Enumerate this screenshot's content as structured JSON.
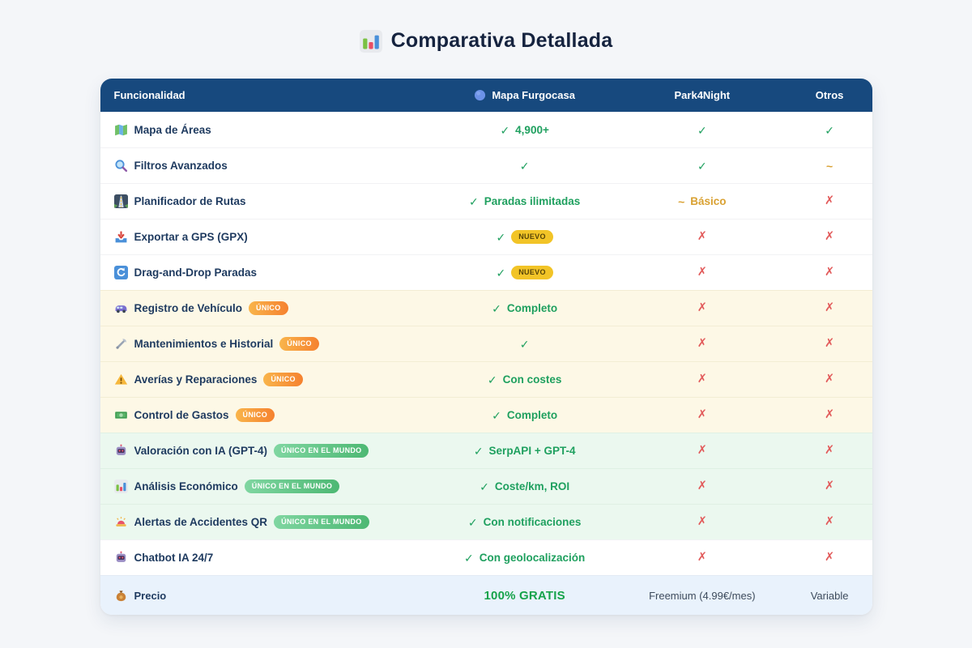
{
  "title": {
    "icon": "bar-chart",
    "text": "Comparativa Detallada"
  },
  "table": {
    "header": {
      "funcionalidad": "Funcionalidad",
      "furgocasa": "Mapa Furgocasa",
      "furgocasa_icon": "globe",
      "park4night": "Park4Night",
      "otros": "Otros"
    },
    "symbols": {
      "check": "✓",
      "cross": "✗",
      "tilde": "~"
    },
    "badge_labels": {
      "nuevo": "NUEVO",
      "unico": "ÚNICO",
      "unico_mundo": "ÚNICO EN EL MUNDO"
    },
    "rows": [
      {
        "icon": "world-map",
        "label": "Mapa de Áreas",
        "badge": null,
        "tint": "white",
        "cells": [
          {
            "mark": "check",
            "text": "4,900+"
          },
          {
            "mark": "check"
          },
          {
            "mark": "check"
          }
        ]
      },
      {
        "icon": "magnifier",
        "label": "Filtros Avanzados",
        "badge": null,
        "tint": "white",
        "cells": [
          {
            "mark": "check"
          },
          {
            "mark": "check"
          },
          {
            "mark": "tilde"
          }
        ]
      },
      {
        "icon": "motorway",
        "label": "Planificador de Rutas",
        "badge": null,
        "tint": "white",
        "cells": [
          {
            "mark": "check",
            "text": "Paradas ilimitadas"
          },
          {
            "mark": "tilde",
            "text": "Básico"
          },
          {
            "mark": "cross"
          }
        ]
      },
      {
        "icon": "inbox-download",
        "label": "Exportar a GPS (GPX)",
        "badge": null,
        "tint": "white",
        "cells": [
          {
            "mark": "check",
            "badge": "nuevo"
          },
          {
            "mark": "cross"
          },
          {
            "mark": "cross"
          }
        ]
      },
      {
        "icon": "reload",
        "label": "Drag-and-Drop Paradas",
        "badge": null,
        "tint": "white",
        "cells": [
          {
            "mark": "check",
            "badge": "nuevo"
          },
          {
            "mark": "cross"
          },
          {
            "mark": "cross"
          }
        ]
      },
      {
        "icon": "van",
        "label": "Registro de Vehículo",
        "badge": "unico",
        "tint": "cream",
        "cells": [
          {
            "mark": "check",
            "text": "Completo"
          },
          {
            "mark": "cross"
          },
          {
            "mark": "cross"
          }
        ]
      },
      {
        "icon": "wrench",
        "label": "Mantenimientos e Historial",
        "badge": "unico",
        "tint": "cream",
        "cells": [
          {
            "mark": "check"
          },
          {
            "mark": "cross"
          },
          {
            "mark": "cross"
          }
        ]
      },
      {
        "icon": "warning",
        "label": "Averías y Reparaciones",
        "badge": "unico",
        "tint": "cream",
        "cells": [
          {
            "mark": "check",
            "text": "Con costes"
          },
          {
            "mark": "cross"
          },
          {
            "mark": "cross"
          }
        ]
      },
      {
        "icon": "banknote",
        "label": "Control de Gastos",
        "badge": "unico",
        "tint": "cream",
        "cells": [
          {
            "mark": "check",
            "text": "Completo"
          },
          {
            "mark": "cross"
          },
          {
            "mark": "cross"
          }
        ]
      },
      {
        "icon": "robot",
        "label": "Valoración con IA (GPT-4)",
        "badge": "unico_mundo",
        "tint": "green",
        "cells": [
          {
            "mark": "check",
            "text": "SerpAPI + GPT-4"
          },
          {
            "mark": "cross"
          },
          {
            "mark": "cross"
          }
        ]
      },
      {
        "icon": "bar-chart",
        "label": "Análisis Económico",
        "badge": "unico_mundo",
        "tint": "green",
        "cells": [
          {
            "mark": "check",
            "text": "Coste/km, ROI"
          },
          {
            "mark": "cross"
          },
          {
            "mark": "cross"
          }
        ]
      },
      {
        "icon": "siren",
        "label": "Alertas de Accidentes QR",
        "badge": "unico_mundo",
        "tint": "green",
        "cells": [
          {
            "mark": "check",
            "text": "Con notificaciones"
          },
          {
            "mark": "cross"
          },
          {
            "mark": "cross"
          }
        ]
      },
      {
        "icon": "robot",
        "label": "Chatbot IA 24/7",
        "badge": null,
        "tint": "white",
        "cells": [
          {
            "mark": "check",
            "text": "Con geolocalización"
          },
          {
            "mark": "cross"
          },
          {
            "mark": "cross"
          }
        ]
      }
    ],
    "footer": {
      "icon": "moneybag",
      "label": "Precio",
      "cells": [
        {
          "text": "100% GRATIS",
          "style": "price"
        },
        {
          "text": "Freemium (4.99€/mes)",
          "style": "plain"
        },
        {
          "text": "Variable",
          "style": "plain"
        }
      ]
    }
  },
  "colors": {
    "page_bg": "#F4F6F9",
    "header_bg": "#17497E",
    "check_green": "#1FA05F",
    "cross_red": "#E25B5B",
    "tilde_orange": "#D9A132",
    "feature_navy": "#1E3A5F",
    "cream_row": "#FDF8E6",
    "green_row": "#EBF8EF",
    "footer_bg": "#E9F2FC",
    "price_green": "#17A34A",
    "badge_nuevo_bg": "#F2C427",
    "badge_unico_from": "#F9B54B",
    "badge_unico_to": "#F5812F",
    "badge_mundo_from": "#7FD6A1",
    "badge_mundo_to": "#4DB873"
  }
}
